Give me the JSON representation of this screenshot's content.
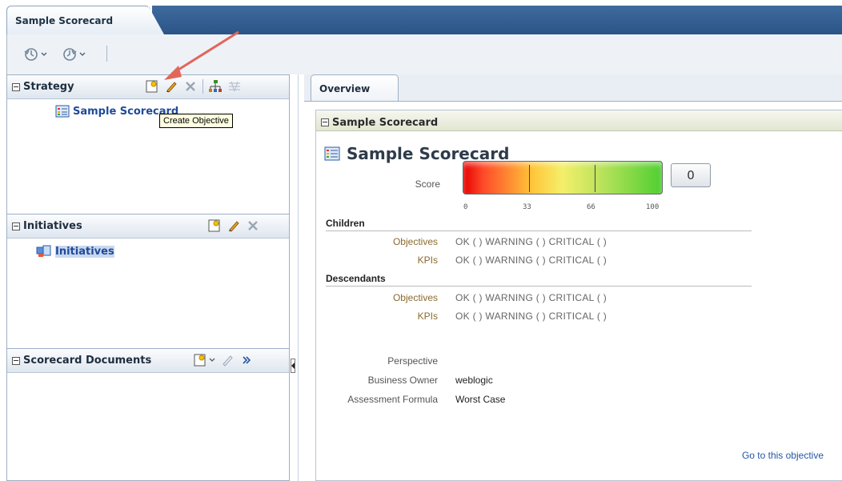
{
  "main_tab": {
    "label": "Sample Scorecard"
  },
  "strategy_panel": {
    "title": "Strategy",
    "tree_items": [
      {
        "label": "Sample Scorecard"
      }
    ]
  },
  "initiatives_panel": {
    "title": "Initiatives",
    "tree_items": [
      {
        "label": "Initiatives"
      }
    ]
  },
  "documents_panel": {
    "title": "Scorecard Documents"
  },
  "tooltip": {
    "text": "Create Objective"
  },
  "overview_tab": {
    "label": "Overview"
  },
  "card": {
    "header": "Sample Scorecard",
    "title": "Sample Scorecard",
    "score_label": "Score",
    "score_value": "0",
    "gauge_ticks": [
      "0",
      "33",
      "66",
      "100"
    ],
    "children_heading": "Children",
    "descendants_heading": "Descendants",
    "children_rows": [
      {
        "label": "Objectives",
        "value": "OK ( )  WARNING ( )  CRITICAL ( )"
      },
      {
        "label": "KPIs",
        "value": "OK ( )  WARNING ( )  CRITICAL ( )"
      }
    ],
    "descendants_rows": [
      {
        "label": "Objectives",
        "value": "OK ( )  WARNING ( )  CRITICAL ( )"
      },
      {
        "label": "KPIs",
        "value": "OK ( )  WARNING ( )  CRITICAL ( )"
      }
    ],
    "properties": [
      {
        "label": "Perspective",
        "value": ""
      },
      {
        "label": "Business Owner",
        "value": "weblogic"
      },
      {
        "label": "Assessment Formula",
        "value": "Worst Case"
      }
    ],
    "goto_link": "Go to this objective"
  },
  "colors": {
    "header_blue": "#2b5586",
    "link_blue": "#1f4a9a",
    "arrow_red": "#e2665a",
    "label_brown": "#8a6a2c"
  }
}
